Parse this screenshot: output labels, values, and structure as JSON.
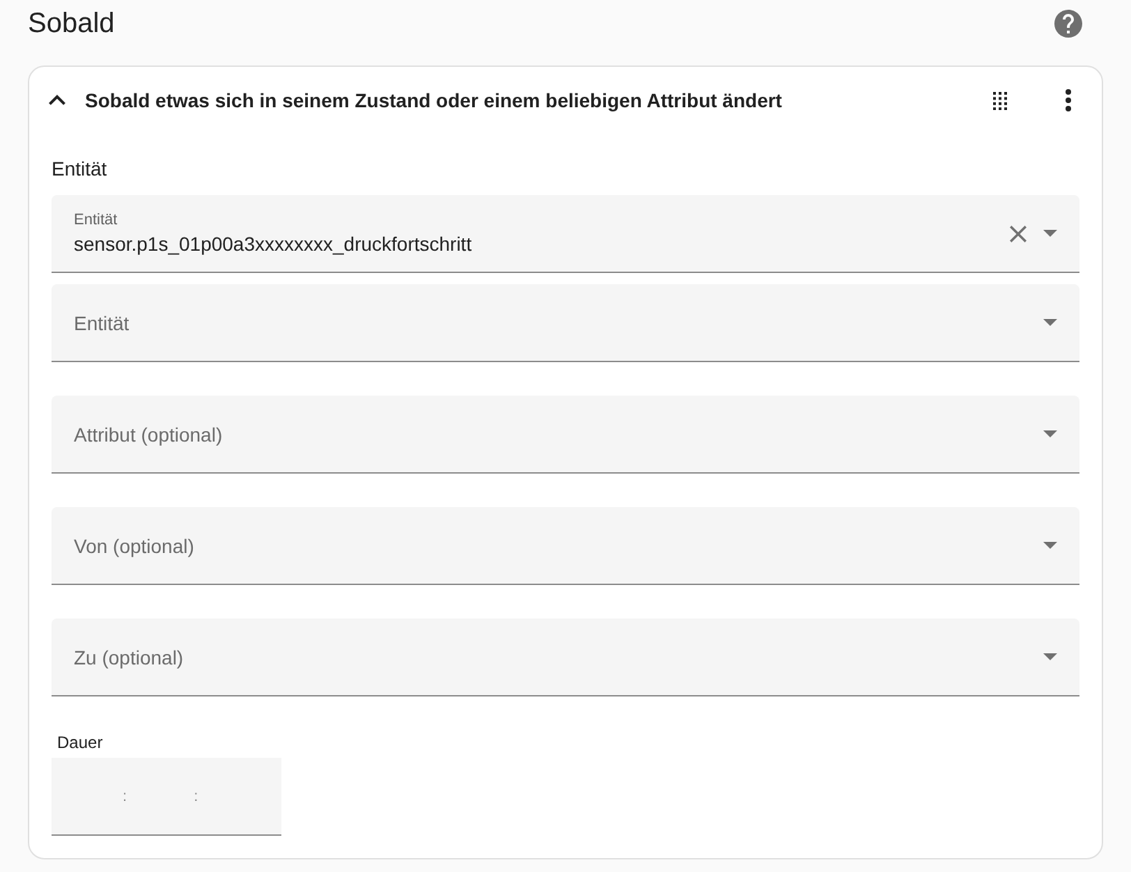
{
  "page": {
    "title": "Sobald"
  },
  "trigger": {
    "expanded": true,
    "title": "Sobald etwas sich in seinem Zustand oder einem beliebigen Attribut ändert",
    "section_label": "Entität",
    "entities": [
      {
        "label": "Entität",
        "value": "sensor.p1s_01p00a3xxxxxxxx_druckfortschritt"
      },
      {
        "placeholder": "Entität"
      }
    ],
    "fields": [
      {
        "placeholder": "Attribut (optional)"
      },
      {
        "placeholder": "Von (optional)"
      },
      {
        "placeholder": "Zu (optional)"
      }
    ],
    "duration": {
      "label": "Dauer",
      "separators": [
        ":",
        ":"
      ]
    }
  }
}
